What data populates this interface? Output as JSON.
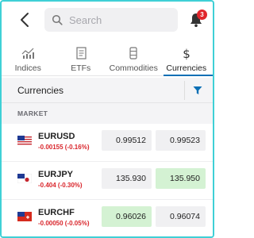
{
  "header": {
    "search_placeholder": "Search",
    "notification_count": "3"
  },
  "tabs": [
    {
      "label": "Indices",
      "icon": "bar-chart-icon",
      "active": false
    },
    {
      "label": "ETFs",
      "icon": "document-icon",
      "active": false
    },
    {
      "label": "Commodities",
      "icon": "oil-barrel-icon",
      "active": false
    },
    {
      "label": "Currencies",
      "icon": "dollar-icon",
      "active": true
    }
  ],
  "section": {
    "title": "Currencies",
    "market_label": "MARKET"
  },
  "rows": [
    {
      "pair": "EURUSD",
      "change": "-0.00155 (-0.16%)",
      "sell": "0.99512",
      "buy": "0.99523",
      "flag": "eu-us-flag-icon"
    },
    {
      "pair": "EURJPY",
      "change": "-0.404 (-0.30%)",
      "sell": "135.930",
      "buy": "135.950",
      "flag": "eu-jp-flag-icon"
    },
    {
      "pair": "EURCHF",
      "change": "-0.00050 (-0.05%)",
      "sell": "0.96026",
      "buy": "0.96074",
      "flag": "eu-ch-flag-icon"
    }
  ],
  "colors": {
    "accent": "#0a6fb5",
    "negative": "#d9252b",
    "badge": "#e0262c",
    "price_up": "#d4f2d3",
    "frame": "#3fd0d6"
  }
}
